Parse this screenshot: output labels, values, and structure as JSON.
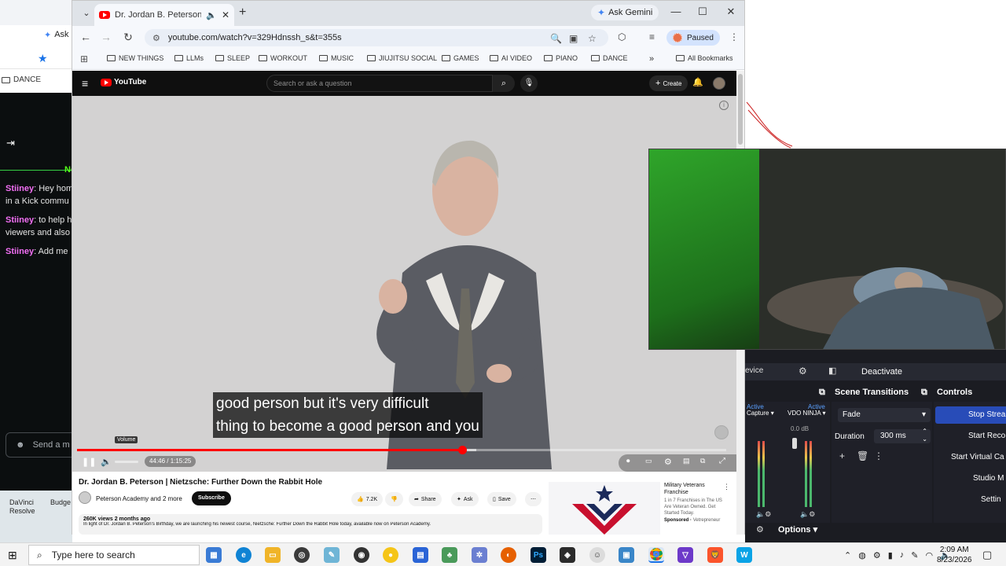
{
  "left_window": {
    "tab_label": "Ask",
    "bookmark_label": "DANCE",
    "chat": {
      "new_label": "Ne",
      "messages": [
        {
          "user": "Stiiney",
          "line1": ": Hey hom",
          "line2": "in a Kick commu"
        },
        {
          "user": "Stiiney",
          "line1": ": to help h",
          "line2": "viewers and also"
        },
        {
          "user": "Stiiney",
          "line1": ": Add me",
          "line2": ""
        }
      ],
      "send_placeholder": "Send a m"
    },
    "desktop_icons": [
      "DaVinci Resolve",
      "Budge"
    ]
  },
  "browser": {
    "tab_title": "Dr. Jordan B. Peterson | Nietz",
    "gemini_label": "Ask Gemini",
    "url": "youtube.com/watch?v=329Hdnssh_s&t=355s",
    "profile_status": "Paused",
    "bookmarks": [
      "NEW THINGS",
      "LLMs",
      "SLEEP",
      "WORKOUT",
      "MUSIC",
      "JIUJITSU SOCIAL",
      "GAMES",
      "AI VIDEO",
      "PIANO",
      "DANCE"
    ],
    "all_bookmarks": "All Bookmarks",
    "overflow": "»"
  },
  "youtube": {
    "logo_text": "YouTube",
    "search_placeholder": "Search or ask a question",
    "create_label": "Create",
    "subtitle_line1": "good person but it's very difficult",
    "subtitle_line2": "thing to become a good person and you",
    "volume_tooltip": "Volume",
    "time_display": "44:46 / 1:15:25",
    "progress_fraction": 0.593,
    "buffer_fraction": 0.615,
    "video_title": "Dr. Jordan B. Peterson | Nietzsche: Further Down the Rabbit Hole",
    "channel": "Peterson Academy and 2 more",
    "subscribe_label": "Subscribe",
    "likes": "7.2K",
    "share_label": "Share",
    "ask_label": "Ask",
    "save_label": "Save",
    "views_meta": "260K views  2 months ago",
    "description": "In light of Dr. Jordan B. Peterson's Birthday, we are launching his newest course, Nietzsche: Further Down the Rabbit Hole today, available now on Peterson Academy.",
    "ad": {
      "title": "Military Veterans Franchise",
      "text": "1 in 7 Franchises in The US Are Veteran Owned. Get Started Today.",
      "sponsored": "Sponsored",
      "advertiser": "Vetrepreneur"
    }
  },
  "obs": {
    "device_label": "evice",
    "deactivate_label": "Deactivate",
    "scene_transitions": "Scene Transitions",
    "controls": "Controls",
    "mixer_active1": "Active",
    "mixer_active2": "Active",
    "audio_capture": "Capture",
    "vdo_ninja": "VDO NINJA",
    "db_label": "0.0 dB",
    "transition": "Fade",
    "duration_label": "Duration",
    "duration_value": "300 ms",
    "buttons": [
      "Stop Strea",
      "Start Reco",
      "Start Virtual Ca",
      "Studio M",
      "Settin"
    ],
    "options_label": "Options"
  },
  "taskbar": {
    "search_placeholder": "Type here to search",
    "time": "2:09 AM",
    "date": "8/23/2026"
  },
  "colors": {
    "yt_red": "#ff0000",
    "obs_active_blue": "#284cb8",
    "kick_green": "#53fc18",
    "chat_username": "#f26ff4"
  }
}
